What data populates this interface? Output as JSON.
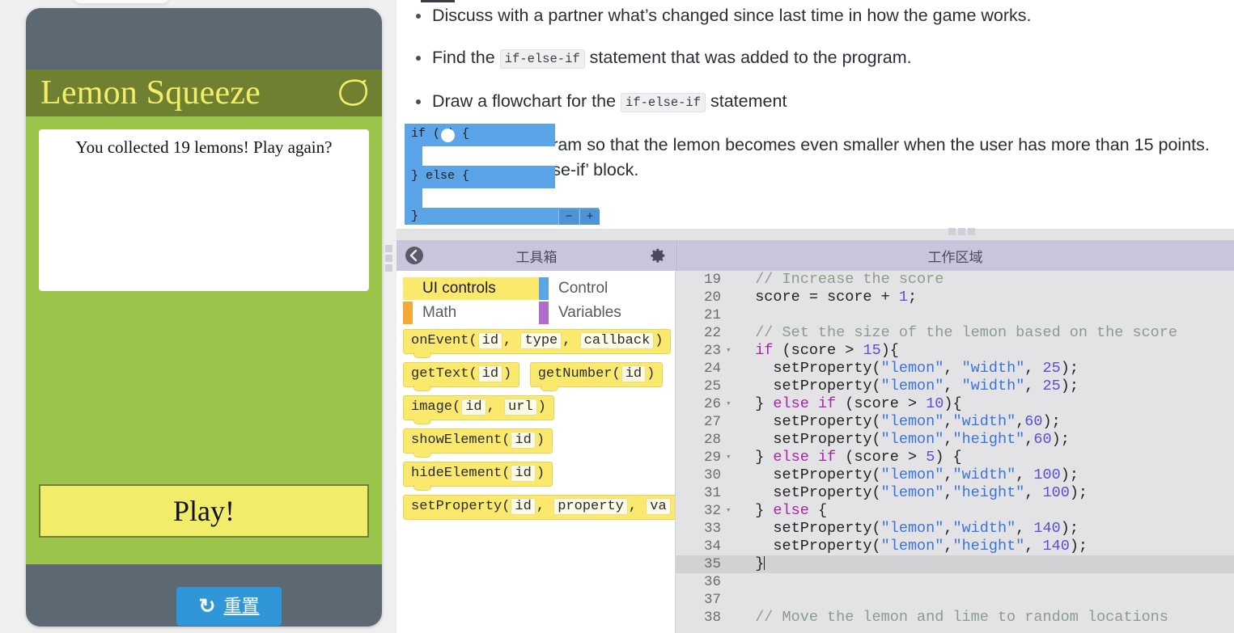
{
  "app": {
    "title": "Lemon Squeeze",
    "lemon_icon": "lemon-icon",
    "message": "You collected 19 lemons! Play again?",
    "play_label": "Play!",
    "reset_label": "重置",
    "reset_icon": "refresh-icon",
    "colors": {
      "device": "#5c6872",
      "screen": "#9ac44a",
      "titlebar": "#6f8031",
      "title_text": "#f2ed6a",
      "play_button": "#f1ec6a",
      "reset_button": "#2f96d8"
    }
  },
  "instructions": {
    "items": [
      {
        "parts": [
          {
            "type": "text",
            "value": "Discuss with a partner what’s changed since last time in how the game works."
          }
        ]
      },
      {
        "parts": [
          {
            "type": "text",
            "value": "Find the "
          },
          {
            "type": "code",
            "value": "if-else-if"
          },
          {
            "type": "text",
            "value": " statement that was added to the program."
          }
        ]
      },
      {
        "parts": [
          {
            "type": "text",
            "value": "Draw a flowchart for the "
          },
          {
            "type": "code",
            "value": "if-else-if"
          },
          {
            "type": "text",
            "value": " statement"
          }
        ]
      },
      {
        "parts": [
          {
            "type": "text",
            "value": "Modify the program so that the lemon becomes even smaller when the user has more than 15 points. expand an `if-else-if’ block."
          }
        ]
      }
    ],
    "bullet_1": "Discuss with a partner what’s changed since last time in how the game works.",
    "bullet_2_pre": "Find the ",
    "bullet_2_chip": "if-else-if",
    "bullet_2_post": " statement that was added to the program.",
    "bullet_3_pre": "Draw a flowchart for the ",
    "bullet_3_chip": "if-else-if",
    "bullet_3_post": " statement",
    "bullet_4": "Modify the program so that the lemon becomes even smaller when the user has more than 15 points. expand an `if-else-if’ block."
  },
  "block_preview": {
    "if_label": "if (      ) {",
    "else_label": "} else {",
    "foot_label": "}",
    "mutator_minus": "−",
    "mutator_plus": "+",
    "color": "#5ba4e8"
  },
  "toolbox": {
    "title": "工具箱",
    "back_icon": "back-arrow-icon",
    "gear_icon": "gear-icon",
    "categories": [
      {
        "label": "UI controls",
        "color": "#fbe96d",
        "active": true
      },
      {
        "label": "Control",
        "color": "#5ba4e8",
        "active": false
      },
      {
        "label": "Math",
        "color": "#f5a833",
        "active": false
      },
      {
        "label": "Variables",
        "color": "#b06ccc",
        "active": false
      }
    ],
    "cat_ui_controls": "UI controls",
    "cat_control": "Control",
    "cat_math": "Math",
    "cat_variables": "Variables",
    "blocks": [
      {
        "name": "onEvent",
        "text": "onEvent(id, type, callback)"
      },
      {
        "name": "getText",
        "text": "getText(id)"
      },
      {
        "name": "getNumber",
        "text": "getNumber(id)"
      },
      {
        "name": "image",
        "text": "image(id, url)"
      },
      {
        "name": "showElement",
        "text": "showElement(id)"
      },
      {
        "name": "hideElement",
        "text": "hideElement(id)"
      },
      {
        "name": "setProperty",
        "text": "setProperty(id, property, value)"
      }
    ],
    "b_onevent_fn": "onEvent(",
    "b_onevent_a1": "id",
    "b_onevent_sep1": ", ",
    "b_onevent_a2": "type",
    "b_onevent_sep2": ", ",
    "b_onevent_a3": "callback",
    "b_onevent_end": ")",
    "b_gettext_fn": "getText(",
    "b_gettext_a1": "id",
    "b_gettext_end": ")",
    "b_getnumber_fn": "getNumber(",
    "b_getnumber_a1": "id",
    "b_getnumber_end": ")",
    "b_image_fn": "image(",
    "b_image_a1": "id",
    "b_image_sep": ", ",
    "b_image_a2": "url",
    "b_image_end": ")",
    "b_show_fn": "showElement(",
    "b_show_a1": "id",
    "b_show_end": ")",
    "b_hide_fn": "hideElement(",
    "b_hide_a1": "id",
    "b_hide_end": ")",
    "b_setprop_fn": "setProperty(",
    "b_setprop_a1": "id",
    "b_setprop_sep1": ", ",
    "b_setprop_a2": "property",
    "b_setprop_sep2": ", ",
    "b_setprop_a3": "va"
  },
  "editor": {
    "title": "工作区域",
    "active_line": 35,
    "lines": [
      {
        "n": "19",
        "fold": "",
        "text": "  // Increase the score"
      },
      {
        "n": "20",
        "fold": "",
        "text": "  score = score + 1;"
      },
      {
        "n": "21",
        "fold": "",
        "text": ""
      },
      {
        "n": "22",
        "fold": "",
        "text": "  // Set the size of the lemon based on the score"
      },
      {
        "n": "23",
        "fold": "▾",
        "text": "  if (score > 15){"
      },
      {
        "n": "24",
        "fold": "",
        "text": "    setProperty(\"lemon\", \"width\", 25);"
      },
      {
        "n": "25",
        "fold": "",
        "text": "    setProperty(\"lemon\", \"width\", 25);"
      },
      {
        "n": "26",
        "fold": "▾",
        "text": "  } else if (score > 10){"
      },
      {
        "n": "27",
        "fold": "",
        "text": "    setProperty(\"lemon\",\"width\",60);"
      },
      {
        "n": "28",
        "fold": "",
        "text": "    setProperty(\"lemon\",\"height\",60);"
      },
      {
        "n": "29",
        "fold": "▾",
        "text": "  } else if (score > 5) {"
      },
      {
        "n": "30",
        "fold": "",
        "text": "    setProperty(\"lemon\",\"width\", 100);"
      },
      {
        "n": "31",
        "fold": "",
        "text": "    setProperty(\"lemon\",\"height\", 100);"
      },
      {
        "n": "32",
        "fold": "▾",
        "text": "  } else {"
      },
      {
        "n": "33",
        "fold": "",
        "text": "    setProperty(\"lemon\",\"width\", 140);"
      },
      {
        "n": "34",
        "fold": "",
        "text": "    setProperty(\"lemon\",\"height\", 140);"
      },
      {
        "n": "35",
        "fold": "",
        "text": "  }"
      },
      {
        "n": "36",
        "fold": "",
        "text": ""
      },
      {
        "n": "37",
        "fold": "",
        "text": ""
      },
      {
        "n": "38",
        "fold": "",
        "text": "  // Move the lemon and lime to random locations"
      }
    ]
  }
}
